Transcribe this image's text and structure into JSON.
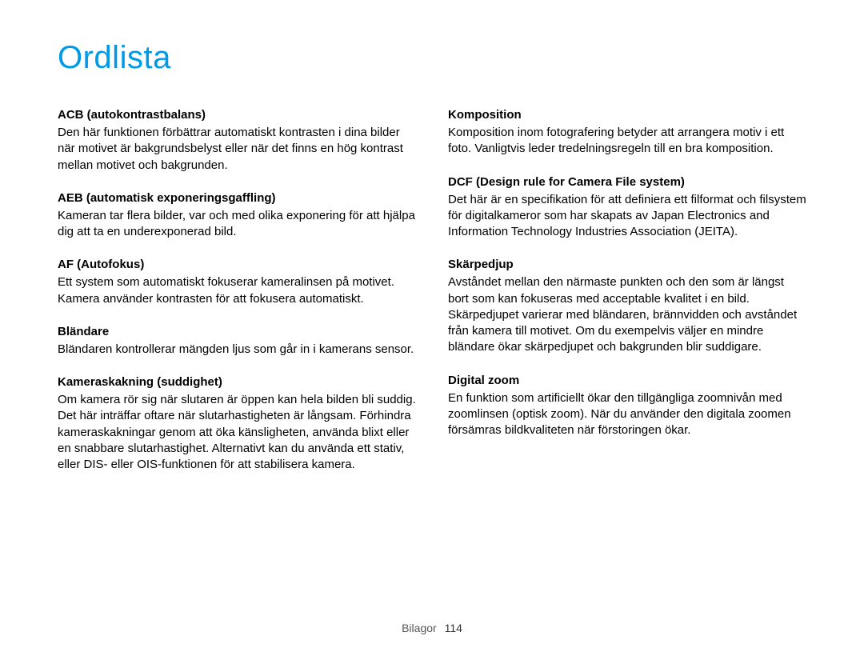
{
  "title": "Ordlista",
  "left_entries": [
    {
      "term": "ACB (autokontrastbalans)",
      "definition": "Den här funktionen förbättrar automatiskt kontrasten i dina bilder när motivet är bakgrundsbelyst eller när det finns en hög kontrast mellan motivet och bakgrunden."
    },
    {
      "term": "AEB (automatisk exponeringsgaffling)",
      "definition": "Kameran tar flera bilder, var och med olika exponering för att hjälpa dig att ta en underexponerad bild."
    },
    {
      "term": "AF (Autofokus)",
      "definition": "Ett system som automatiskt fokuserar kameralinsen på motivet. Kamera använder kontrasten för att fokusera automatiskt."
    },
    {
      "term": "Bländare",
      "definition": "Bländaren kontrollerar mängden ljus som går in i kamerans sensor."
    },
    {
      "term": "Kameraskakning (suddighet)",
      "definition": "Om kamera rör sig när slutaren är öppen kan hela bilden bli suddig. Det här inträffar oftare när slutarhastigheten är långsam. Förhindra kameraskakningar genom att öka känsligheten, använda blixt eller en snabbare slutarhastighet. Alternativt kan du använda ett stativ, eller DIS- eller OIS-funktionen för att stabilisera kamera."
    }
  ],
  "right_entries": [
    {
      "term": "Komposition",
      "definition": "Komposition inom fotografering betyder att arrangera motiv i ett foto. Vanligtvis leder tredelningsregeln till en bra komposition."
    },
    {
      "term": "DCF (Design rule for Camera File system)",
      "definition": "Det här är en specifikation för att definiera ett filformat och filsystem för digitalkameror som har skapats av Japan Electronics and Information Technology Industries Association (JEITA)."
    },
    {
      "term": "Skärpedjup",
      "definition": "Avståndet mellan den närmaste punkten och den som är längst bort som kan fokuseras med acceptable kvalitet i en bild. Skärpedjupet varierar med bländaren, brännvidden och avståndet från kamera till motivet. Om du exempelvis väljer en mindre bländare ökar skärpedjupet och bakgrunden blir suddigare."
    },
    {
      "term": "Digital zoom",
      "definition": "En funktion som artificiellt ökar den tillgängliga zoomnivån med zoomlinsen (optisk zoom). När du använder den digitala zoomen försämras bildkvaliteten när förstoringen ökar."
    }
  ],
  "footer": {
    "label": "Bilagor",
    "page": "114"
  }
}
